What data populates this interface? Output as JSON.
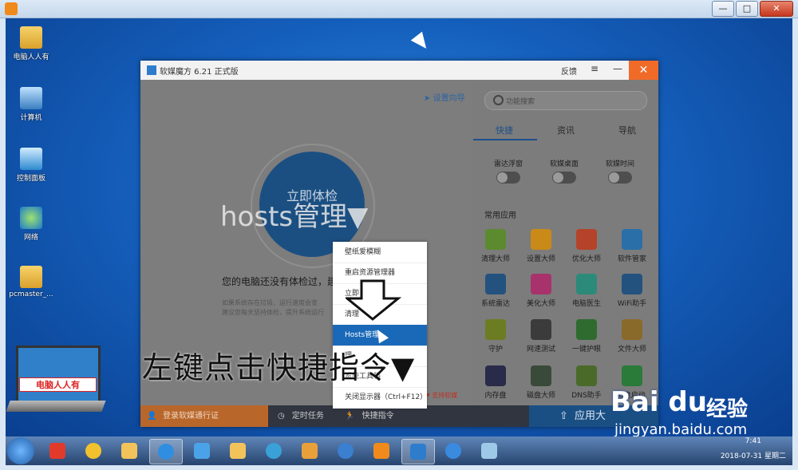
{
  "colors": {
    "accent": "#1a69b8",
    "close": "#f06a28",
    "login_bar": "#b9662a"
  },
  "desktop_icons": [
    {
      "label": "电脑人人有",
      "icon": "folder-user-icon"
    },
    {
      "label": "计算机",
      "icon": "computer-icon"
    },
    {
      "label": "控制面板",
      "icon": "control-panel-icon"
    },
    {
      "label": "网络",
      "icon": "network-icon"
    },
    {
      "label": "pcmaster_...",
      "icon": "folder-icon"
    }
  ],
  "desktop_logo": {
    "text": "电脑人人有"
  },
  "app": {
    "title": "软媒魔方 6.21 正式版",
    "feedback": "反馈",
    "menu_icon": "≡",
    "minimize": "—",
    "close": "✕",
    "guide": "设置向导",
    "check_button": "立即体检",
    "overlay_title": "hosts管理▼",
    "warning": "您的电脑还没有体检过，建",
    "note_line1": "如果系统存在垃圾，运行速度会变",
    "note_line2": "建议您每天坚持体检，提升系统运行",
    "support": "❤ 支持软媒",
    "search_placeholder": "功能搜索",
    "tabs": [
      "快捷",
      "资讯",
      "导航"
    ],
    "toggles": [
      "雷达浮窗",
      "软媒桌面",
      "软媒时间"
    ],
    "section_title": "常用应用",
    "apps": [
      {
        "label": "清理大师",
        "color": "#5c8a2f"
      },
      {
        "label": "设置大师",
        "color": "#c98a17"
      },
      {
        "label": "优化大师",
        "color": "#b5432a"
      },
      {
        "label": "软件管家",
        "color": "#2a6fa8"
      },
      {
        "label": "系统雷达",
        "color": "#23527f"
      },
      {
        "label": "美化大师",
        "color": "#a8326b"
      },
      {
        "label": "电脑医生",
        "color": "#2c8a7a"
      },
      {
        "label": "WiFi助手",
        "color": "#23527f"
      },
      {
        "label": "守护",
        "color": "#6b7c23"
      },
      {
        "label": "网速测试",
        "color": "#3b3b3b"
      },
      {
        "label": "一键护眼",
        "color": "#2f6b2f"
      },
      {
        "label": "文件大师",
        "color": "#8a6a2a"
      },
      {
        "label": "内存盘",
        "color": "#2a2a4a"
      },
      {
        "label": "磁盘大师",
        "color": "#3a4a3a"
      },
      {
        "label": "DNS助手",
        "color": "#4a6a2a"
      },
      {
        "label": "U盘启动",
        "color": "#2a7a3a"
      }
    ],
    "bottom": {
      "login": "登录软媒通行证",
      "timer": "定时任务",
      "quick": "快捷指令",
      "app_store": "应用大"
    }
  },
  "context_menu": [
    "壁纸爱模糊",
    "重启资源管理器",
    "立即",
    "清理",
    "Hosts管理",
    "理",
    "系统工具箱",
    "关闭显示器（Ctrl+F12）"
  ],
  "annotation": "左键点击快捷指令▼",
  "watermark": {
    "brand": "Bai du",
    "suffix": "经验",
    "url": "jingyan.baidu.com"
  },
  "taskbar": {
    "items": [
      {
        "icon": "recycle-icon",
        "color": "#e23a2a"
      },
      {
        "icon": "chrome-icon",
        "color": "#f2c12e"
      },
      {
        "icon": "folder-icon",
        "color": "#f2c35a"
      },
      {
        "icon": "app-icon",
        "color": "#2f8ee0"
      },
      {
        "icon": "monitor-icon",
        "color": "#4aa3e8"
      },
      {
        "icon": "explorer-icon",
        "color": "#f2c35a"
      },
      {
        "icon": "fan-icon",
        "color": "#3aa0d8"
      },
      {
        "icon": "paint-icon",
        "color": "#e8a03a"
      },
      {
        "icon": "circle-app-icon",
        "color": "#3a7fd0"
      },
      {
        "icon": "player-icon",
        "color": "#f08a1c"
      },
      {
        "icon": "magic-cube-icon",
        "color": "#2e7ccc"
      },
      {
        "icon": "ie-icon",
        "color": "#3a8ae0"
      },
      {
        "icon": "window-icon",
        "color": "#9ec8e8"
      }
    ],
    "time": "7:41",
    "date": "2018-07-31 星期二"
  }
}
